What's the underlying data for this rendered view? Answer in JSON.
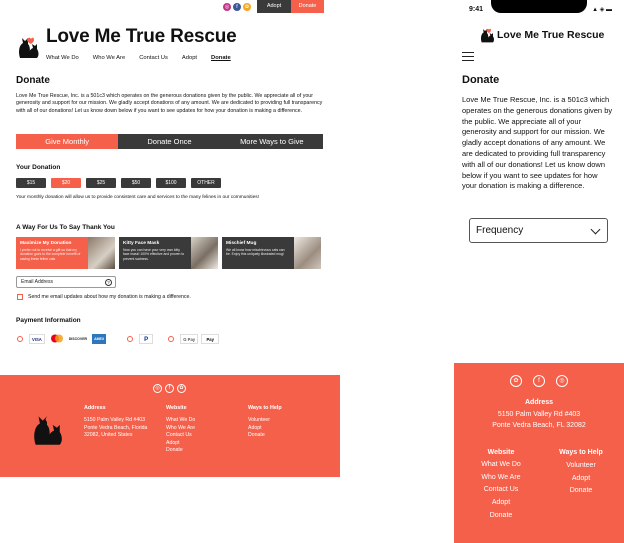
{
  "brand": {
    "name": "Love Me True Rescue",
    "accent": "#f5604b",
    "dark": "#3a3a3a"
  },
  "topbar": {
    "social_icons": [
      "instagram-icon",
      "facebook-icon",
      "petfinder-icon"
    ],
    "adopt": "Adopt",
    "donate": "Donate"
  },
  "nav": {
    "items": [
      "What We Do",
      "Who We Are",
      "Contact Us",
      "Adopt",
      "Donate"
    ],
    "active": "Donate"
  },
  "page": {
    "title": "Donate",
    "intro": "Love Me True Rescue, Inc. is a 501c3 which operates on the generous donations given by the public. We appreciate all of your generosity and support for our mission. We gladly accept donations of any amount. We are dedicated to providing full transparency with all of our donations! Let us know down below if you want to see updates for how your donation is making a difference."
  },
  "tabs": [
    {
      "label": "Give Monthly",
      "active": true
    },
    {
      "label": "Donate Once",
      "active": false
    },
    {
      "label": "More Ways to Give",
      "active": false
    }
  ],
  "donation": {
    "heading": "Your Donation",
    "amounts": [
      "$15",
      "$20",
      "$25",
      "$50",
      "$100",
      "OTHER"
    ],
    "selected": "$20",
    "note": "Your monthly donation will allow us to provide consistent care and services to the many felines in our communities!"
  },
  "thanks": {
    "heading": "A Way For Us To Say Thank You",
    "cards": [
      {
        "title": "Maximize My Donation",
        "desc": "I prefer not to receive a gift so that my donation goes to the complete benefit of saving these feline cats"
      },
      {
        "title": "Kitty Face Mask",
        "desc": "Now you can have your very own kitty face mask! 100% effective and proven to prevent sadness."
      },
      {
        "title": "Mischief Mug",
        "desc": "We all know how mischievous cats can be. Enjoy this uniquely illustrated mug!"
      }
    ]
  },
  "email": {
    "placeholder": "Email Address",
    "help": "?"
  },
  "updates_label": "Send me email updates about how my donation is making a difference.",
  "payment": {
    "heading": "Payment Information",
    "cards": [
      "VISA",
      "MC",
      "DISCOVER",
      "AMEX"
    ],
    "paypal": "P",
    "gpay": "G Pay",
    "applepay": " Pay"
  },
  "footer": {
    "address_heading": "Address",
    "address_lines": [
      "5150 Palm Valley Rd #403",
      "Ponte Vedra Beach, Florida",
      "32082, United States"
    ],
    "website_heading": "Website",
    "website_links": [
      "What We Do",
      "Who We Are",
      "Contact Us",
      "Adopt",
      "Donate"
    ],
    "help_heading": "Ways to Help",
    "help_links": [
      "Volunteer",
      "Adopt",
      "Donate"
    ]
  },
  "mobile": {
    "time": "9:41",
    "system": "▲ ◈ ▬",
    "frequency": "Frequency",
    "address_lines": [
      "5150 Palm Valley Rd #403",
      "Ponte Vedra Beach, FL 32082"
    ]
  }
}
